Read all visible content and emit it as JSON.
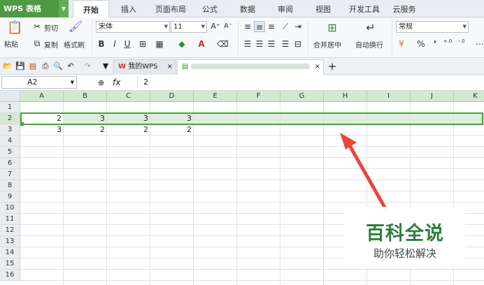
{
  "app": {
    "name": "WPS 表格"
  },
  "menu": {
    "tabs": [
      "开始",
      "插入",
      "页面布局",
      "公式",
      "数据",
      "审阅",
      "视图",
      "开发工具",
      "云服务"
    ],
    "active": "开始"
  },
  "ribbon": {
    "cut": "剪切",
    "paste": "粘贴",
    "copy": "复制",
    "format_painter": "格式刷",
    "font_name": "宋体",
    "font_size": "11",
    "merge_center": "合并居中",
    "wrap_text": "自动换行",
    "number_format": "常规",
    "percent": "%",
    "decimal_inc": ".0\n.00",
    "bold": "B",
    "italic": "I",
    "underline": "U"
  },
  "doctabs": {
    "wps_home": "我的WPS"
  },
  "formula_bar": {
    "cell_ref": "A2",
    "fx": "fx",
    "value": "2"
  },
  "grid": {
    "columns": [
      "A",
      "B",
      "C",
      "D",
      "E",
      "F",
      "G",
      "H",
      "I",
      "J",
      "K"
    ],
    "rows": [
      "1",
      "2",
      "3",
      "4",
      "5",
      "6",
      "7",
      "8",
      "9",
      "10",
      "11",
      "12",
      "13",
      "14",
      "15",
      "16"
    ],
    "cells": [
      {
        "row": 2,
        "col": "A",
        "value": "2"
      },
      {
        "row": 2,
        "col": "B",
        "value": "3"
      },
      {
        "row": 2,
        "col": "C",
        "value": "3"
      },
      {
        "row": 2,
        "col": "D",
        "value": "3"
      },
      {
        "row": 3,
        "col": "A",
        "value": "3"
      },
      {
        "row": 3,
        "col": "B",
        "value": "2"
      },
      {
        "row": 3,
        "col": "C",
        "value": "2"
      },
      {
        "row": 3,
        "col": "D",
        "value": "2"
      }
    ],
    "selected_row": "2"
  },
  "watermark": {
    "title": "百科全说",
    "subtitle": "助你轻松解决"
  },
  "colors": {
    "accent": "#4e9a44",
    "arrow": "#e8463c",
    "selection": "#4c9f42"
  }
}
